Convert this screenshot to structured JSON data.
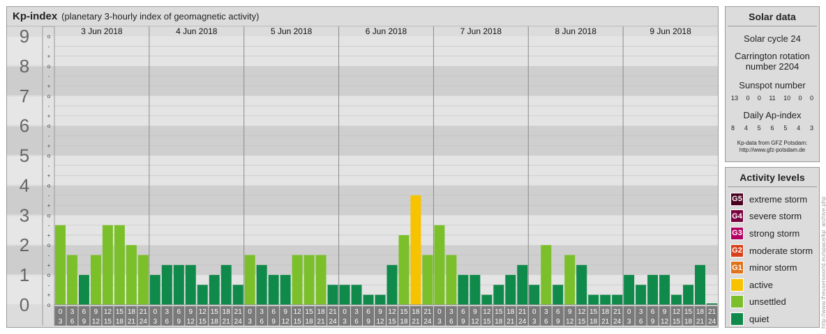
{
  "header": {
    "title": "Kp-index",
    "subtitle": "(planetary 3-hourly index of geomagnetic activity)"
  },
  "chart_data": {
    "type": "bar",
    "title": "Kp-index",
    "subtitle": "(planetary 3-hourly index of geomagnetic activity)",
    "y_range": [
      0,
      9
    ],
    "y_ticks": [
      "0",
      "1",
      "2",
      "3",
      "4",
      "5",
      "6",
      "7",
      "8",
      "9"
    ],
    "minor_tick_labels": [
      "-",
      "o",
      "+"
    ],
    "days": [
      "3 Jun 2018",
      "4 Jun 2018",
      "5 Jun 2018",
      "6 Jun 2018",
      "7 Jun 2018",
      "8 Jun 2018",
      "9 Jun 2018"
    ],
    "interval_labels": [
      [
        "0",
        "3"
      ],
      [
        "3",
        "6"
      ],
      [
        "6",
        "9"
      ],
      [
        "9",
        "12"
      ],
      [
        "12",
        "15"
      ],
      [
        "15",
        "18"
      ],
      [
        "18",
        "21"
      ],
      [
        "21",
        "24"
      ]
    ],
    "values": [
      [
        2.667,
        1.667,
        1.0,
        1.667,
        2.667,
        2.667,
        2.0,
        1.667
      ],
      [
        1.0,
        1.333,
        1.333,
        1.333,
        0.667,
        1.0,
        1.333,
        0.667
      ],
      [
        1.667,
        1.333,
        1.0,
        1.0,
        1.667,
        1.667,
        1.667,
        0.667
      ],
      [
        0.667,
        0.667,
        0.333,
        0.333,
        1.333,
        2.333,
        3.667,
        1.667
      ],
      [
        2.667,
        1.667,
        1.0,
        1.0,
        0.333,
        0.667,
        1.0,
        1.333
      ],
      [
        0.667,
        2.0,
        0.667,
        1.667,
        1.333,
        0.333,
        0.333,
        0.333
      ],
      [
        1.0,
        0.667,
        1.0,
        1.0,
        0.333,
        0.667,
        1.333,
        null
      ]
    ]
  },
  "solar": {
    "title": "Solar data",
    "cycle": "Solar cycle 24",
    "carrington": "Carrington rotation number 2204",
    "sunspot_label": "Sunspot number",
    "sunspot_values": [
      "13",
      "0",
      "0",
      "11",
      "10",
      "0",
      "0"
    ],
    "ap_label": "Daily Ap-index",
    "ap_values": [
      "8",
      "4",
      "5",
      "6",
      "5",
      "4",
      "3"
    ],
    "credit_line1": "Kp-data from GFZ Potsdam:",
    "credit_line2": "http://www.gfz-potsdam.de"
  },
  "activity": {
    "title": "Activity levels",
    "levels": [
      {
        "badge": "G5",
        "label": "extreme storm",
        "color": "#4a0020"
      },
      {
        "badge": "G4",
        "label": "severe storm",
        "color": "#7a0040"
      },
      {
        "badge": "G3",
        "label": "strong storm",
        "color": "#b20060"
      },
      {
        "badge": "G2",
        "label": "moderate storm",
        "color": "#d8401c"
      },
      {
        "badge": "G1",
        "label": "minor storm",
        "color": "#e0721a"
      },
      {
        "badge": "",
        "label": "active",
        "color": "#f7c300"
      },
      {
        "badge": "",
        "label": "unsettled",
        "color": "#7bc02a"
      },
      {
        "badge": "",
        "label": "quiet",
        "color": "#0f8a4a"
      }
    ]
  },
  "side_text": "http://www.theusersworld.eu/space/kp_archive.php"
}
